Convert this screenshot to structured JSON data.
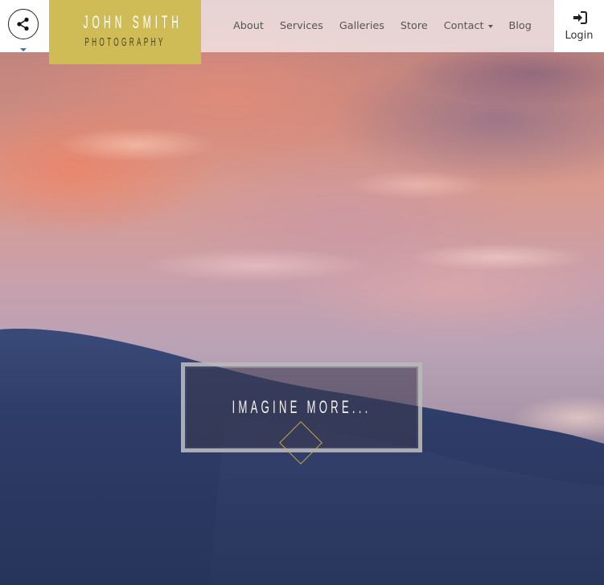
{
  "header": {
    "logo": {
      "name": "JOHN SMITH",
      "subtitle": "PHOTOGRAPHY"
    },
    "nav": [
      {
        "label": "About"
      },
      {
        "label": "Services"
      },
      {
        "label": "Galleries"
      },
      {
        "label": "Store"
      },
      {
        "label": "Contact",
        "has_dropdown": true
      },
      {
        "label": "Blog"
      }
    ],
    "login_label": "Login",
    "share_icon": "share-icon",
    "login_icon": "sign-in-icon"
  },
  "hero": {
    "tagline": "IMAGINE MORE...",
    "decoration_icon": "diamond-icon"
  },
  "colors": {
    "logo_background": "#cfbc57",
    "accent_gold": "#c8a64a",
    "nav_text": "#555555"
  }
}
